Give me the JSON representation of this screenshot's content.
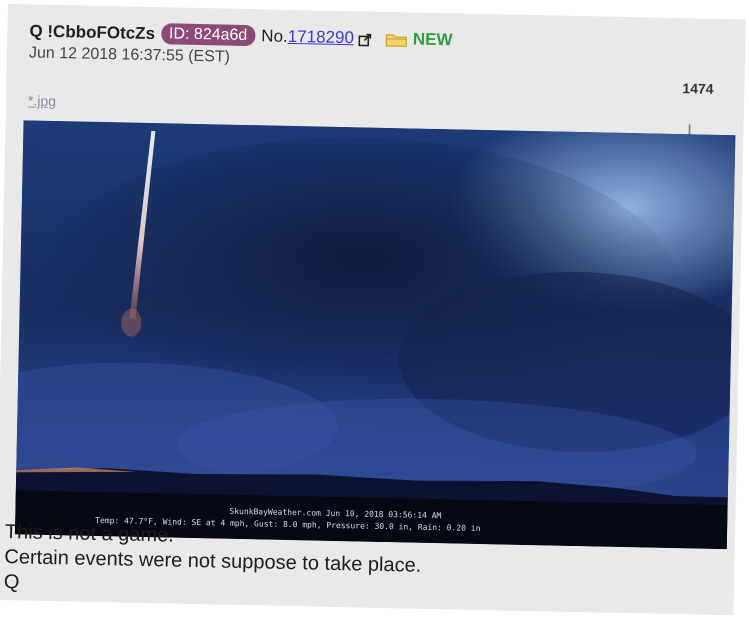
{
  "post": {
    "author": "Q !CbboFOtcZs",
    "id_badge": "ID: 824a6d",
    "no_label": "No.",
    "post_number": "1718290",
    "new_label": "NEW",
    "date": "Jun 12 2018 16:37:55 (EST)",
    "count": "1474",
    "filename": "*.jpg"
  },
  "image": {
    "caption_line1": "SkunkBayWeather.com  Jun 10, 2018  03:56:14 AM",
    "caption_line2": "Temp:  47.7°F, Wind: SE  at    4 mph, Gust:  8.0 mph, Pressure:  30.0 in, Rain: 0.20 in"
  },
  "body": {
    "line1": "This is not a game.",
    "line2": "Certain events were not suppose to take place.",
    "line3": "Q"
  },
  "colors": {
    "id_badge": "#8d4a78",
    "post_link": "#3a3ad0",
    "new_label": "#2e9e3f",
    "card_background": "#e9e9e9"
  },
  "icons": {
    "external_link": "external-link-icon",
    "folder": "folder-icon",
    "download": "download-icon"
  }
}
